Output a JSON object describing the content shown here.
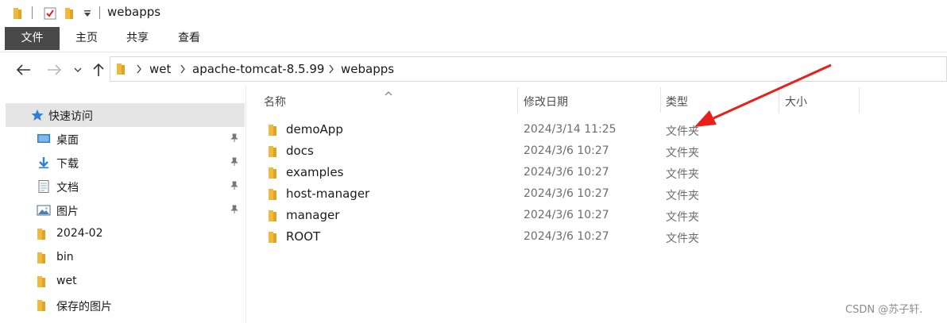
{
  "window": {
    "title": "webapps"
  },
  "ribbon": {
    "tabs": [
      "文件",
      "主页",
      "共享",
      "查看"
    ]
  },
  "address": {
    "crumbs": [
      "wet",
      "apache-tomcat-8.5.99",
      "webapps"
    ]
  },
  "nav_pane": {
    "quick_access": "快速访问",
    "items": [
      {
        "label": "桌面",
        "icon": "desktop-icon",
        "pinned": true
      },
      {
        "label": "下载",
        "icon": "download-icon",
        "pinned": true
      },
      {
        "label": "文档",
        "icon": "document-icon",
        "pinned": true
      },
      {
        "label": "图片",
        "icon": "pictures-icon",
        "pinned": true
      },
      {
        "label": "2024-02",
        "icon": "folder-icon",
        "pinned": false
      },
      {
        "label": "bin",
        "icon": "folder-icon",
        "pinned": false
      },
      {
        "label": "wet",
        "icon": "folder-icon",
        "pinned": false
      },
      {
        "label": "保存的图片",
        "icon": "folder-icon",
        "pinned": false
      }
    ]
  },
  "file_list": {
    "columns": {
      "name": "名称",
      "date": "修改日期",
      "type": "类型",
      "size": "大小"
    },
    "rows": [
      {
        "name": "demoApp",
        "date": "2024/3/14 11:25",
        "type": "文件夹"
      },
      {
        "name": "docs",
        "date": "2024/3/6 10:27",
        "type": "文件夹"
      },
      {
        "name": "examples",
        "date": "2024/3/6 10:27",
        "type": "文件夹"
      },
      {
        "name": "host-manager",
        "date": "2024/3/6 10:27",
        "type": "文件夹"
      },
      {
        "name": "manager",
        "date": "2024/3/6 10:27",
        "type": "文件夹"
      },
      {
        "name": "ROOT",
        "date": "2024/3/6 10:27",
        "type": "文件夹"
      }
    ]
  },
  "watermark": "CSDN @苏子轩.",
  "colors": {
    "folder": "#f0b93a",
    "folder_dark": "#dca52a",
    "file_tab": "#494949",
    "selection": "#e5e5e5",
    "annotation_arrow": "#e8201c"
  }
}
